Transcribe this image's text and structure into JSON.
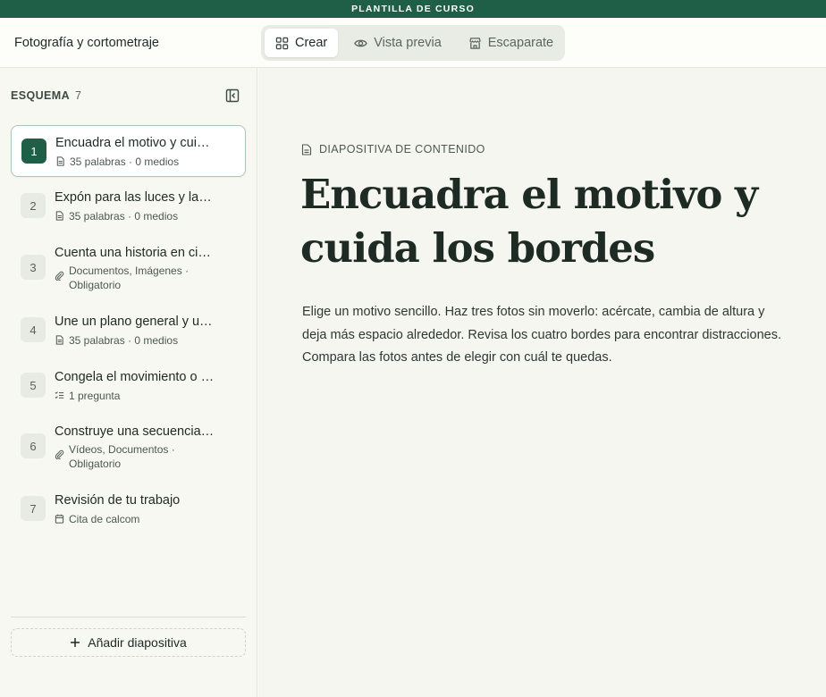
{
  "banner": {
    "text": "PLANTILLA DE CURSO"
  },
  "header": {
    "course_title": "Fotografía y cortometraje",
    "tabs": [
      {
        "label": "Crear",
        "icon": "grid-icon",
        "active": true
      },
      {
        "label": "Vista previa",
        "icon": "eye-icon",
        "active": false
      },
      {
        "label": "Escaparate",
        "icon": "store-icon",
        "active": false
      }
    ]
  },
  "sidebar": {
    "heading": "ESQUEMA",
    "count": "7",
    "slides": [
      {
        "number": "1",
        "title": "Encuadra el motivo y cuida los bordes",
        "meta": "35 palabras · 0 medios",
        "meta_icon": "document-icon",
        "active": true
      },
      {
        "number": "2",
        "title": "Expón para las luces y las sombras",
        "meta": "35 palabras · 0 medios",
        "meta_icon": "document-icon",
        "active": false
      },
      {
        "number": "3",
        "title": "Cuenta una historia en cinco fotos",
        "meta": "Documentos, Imágenes · Obligatorio",
        "meta_icon": "paperclip-icon",
        "active": false
      },
      {
        "number": "4",
        "title": "Une un plano general y un detalle",
        "meta": "35 palabras · 0 medios",
        "meta_icon": "document-icon",
        "active": false
      },
      {
        "number": "5",
        "title": "Congela el movimiento o desenfócalo",
        "meta": "1 pregunta",
        "meta_icon": "checklist-icon",
        "active": false
      },
      {
        "number": "6",
        "title": "Construye una secuencia de planos",
        "meta": "Vídeos, Documentos · Obligatorio",
        "meta_icon": "paperclip-icon",
        "active": false
      },
      {
        "number": "7",
        "title": "Revisión de tu trabajo",
        "meta": "Cita de calcom",
        "meta_icon": "calendar-icon",
        "active": false
      }
    ],
    "add_label": "Añadir diapositiva"
  },
  "main": {
    "type_label": "DIAPOSITIVA DE CONTENIDO",
    "title": "Encuadra el motivo y cuida los bordes",
    "body": "Elige un motivo sencillo. Haz tres fotos sin moverlo: acércate, cambia de altura y deja más espacio alrededor. Revisa los cuatro bordes para encontrar distracciones. Compara las fotos antes de elegir con cuál te quedas."
  },
  "colors": {
    "brand": "#1f5e47",
    "sidebar_bg": "#f6f8f1",
    "main_bg": "#f5f6f0",
    "active_border": "#a9c7b8"
  }
}
